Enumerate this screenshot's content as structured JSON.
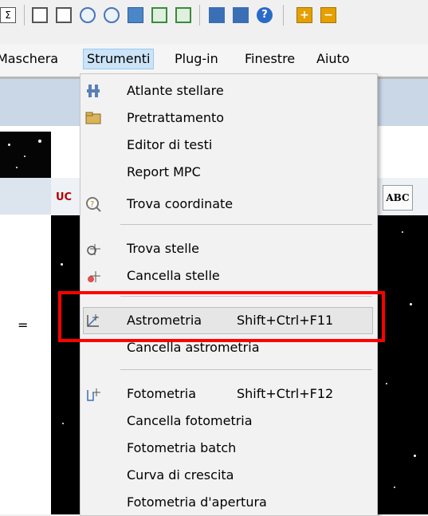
{
  "toolbar": {
    "icons": [
      "sum-icon",
      "window-icon",
      "window-list-icon",
      "zoom-in-icon",
      "zoom-out-icon",
      "monitor-icon",
      "image-grid-icon",
      "settings-grid-icon",
      "bars-icon",
      "star-atlas-icon",
      "help-icon",
      "plus-icon",
      "minus-icon"
    ]
  },
  "menubar": {
    "items": [
      "Maschera",
      "Strumenti",
      "Plug-in",
      "Finestre",
      "Aiuto"
    ],
    "active": "Strumenti"
  },
  "background": {
    "tab_label": "UC",
    "abc_button": "ABC",
    "side_text": "="
  },
  "menu": {
    "items": [
      {
        "label": "Atlante stellare",
        "icon": "star-atlas-icon",
        "shortcut": ""
      },
      {
        "label": "Pretrattamento",
        "icon": "folder-icon",
        "shortcut": ""
      },
      {
        "label": "Editor di testi",
        "icon": "",
        "shortcut": ""
      },
      {
        "label": "Report MPC",
        "icon": "",
        "shortcut": ""
      },
      {
        "label": "Trova coordinate",
        "icon": "search-coordinates-icon",
        "shortcut": ""
      },
      {
        "label": "Trova stelle",
        "icon": "find-stars-icon",
        "shortcut": ""
      },
      {
        "label": "Cancella stelle",
        "icon": "clear-stars-icon",
        "shortcut": ""
      },
      {
        "label": "Astrometria",
        "icon": "astrometry-icon",
        "shortcut": "Shift+Ctrl+F11"
      },
      {
        "label": "Cancella astrometria",
        "icon": "",
        "shortcut": ""
      },
      {
        "label": "Fotometria",
        "icon": "photometry-icon",
        "shortcut": "Shift+Ctrl+F12"
      },
      {
        "label": "Cancella fotometria",
        "icon": "",
        "shortcut": ""
      },
      {
        "label": "Fotometria batch",
        "icon": "",
        "shortcut": ""
      },
      {
        "label": "Curva di crescita",
        "icon": "",
        "shortcut": ""
      },
      {
        "label": "Fotometria d'apertura",
        "icon": "",
        "shortcut": ""
      }
    ],
    "highlighted": "Astrometria"
  },
  "colors": {
    "highlight_box": "#ff0000",
    "menu_bg": "#f2f2f2",
    "active_menu": "#cce4f7"
  }
}
